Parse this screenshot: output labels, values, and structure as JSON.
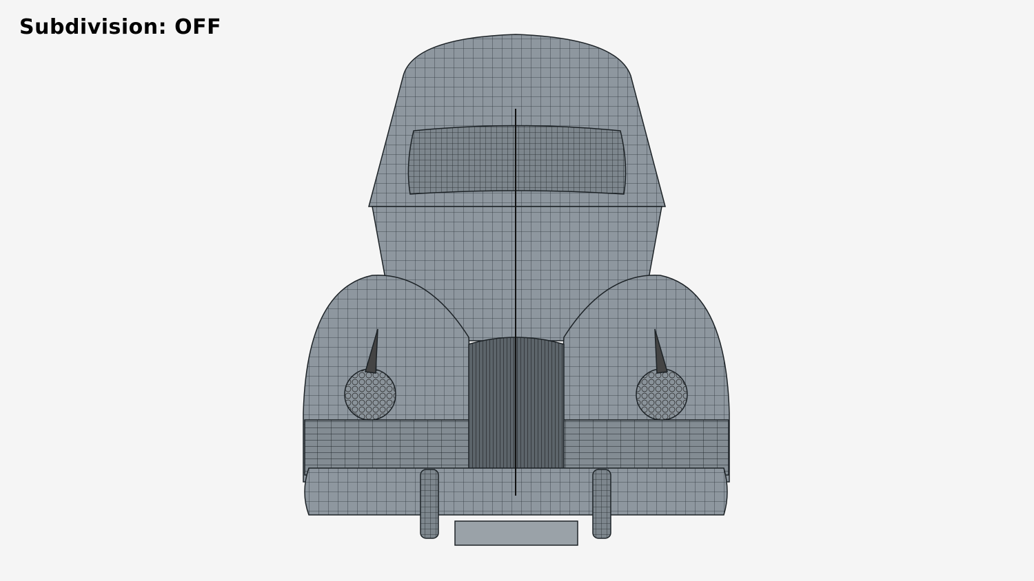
{
  "overlay": {
    "label": "Subdivision: OFF"
  },
  "colors": {
    "background": "#f5f5f5",
    "body": "#8e979f",
    "wire": "#222a30",
    "glass": "#6f777d"
  }
}
